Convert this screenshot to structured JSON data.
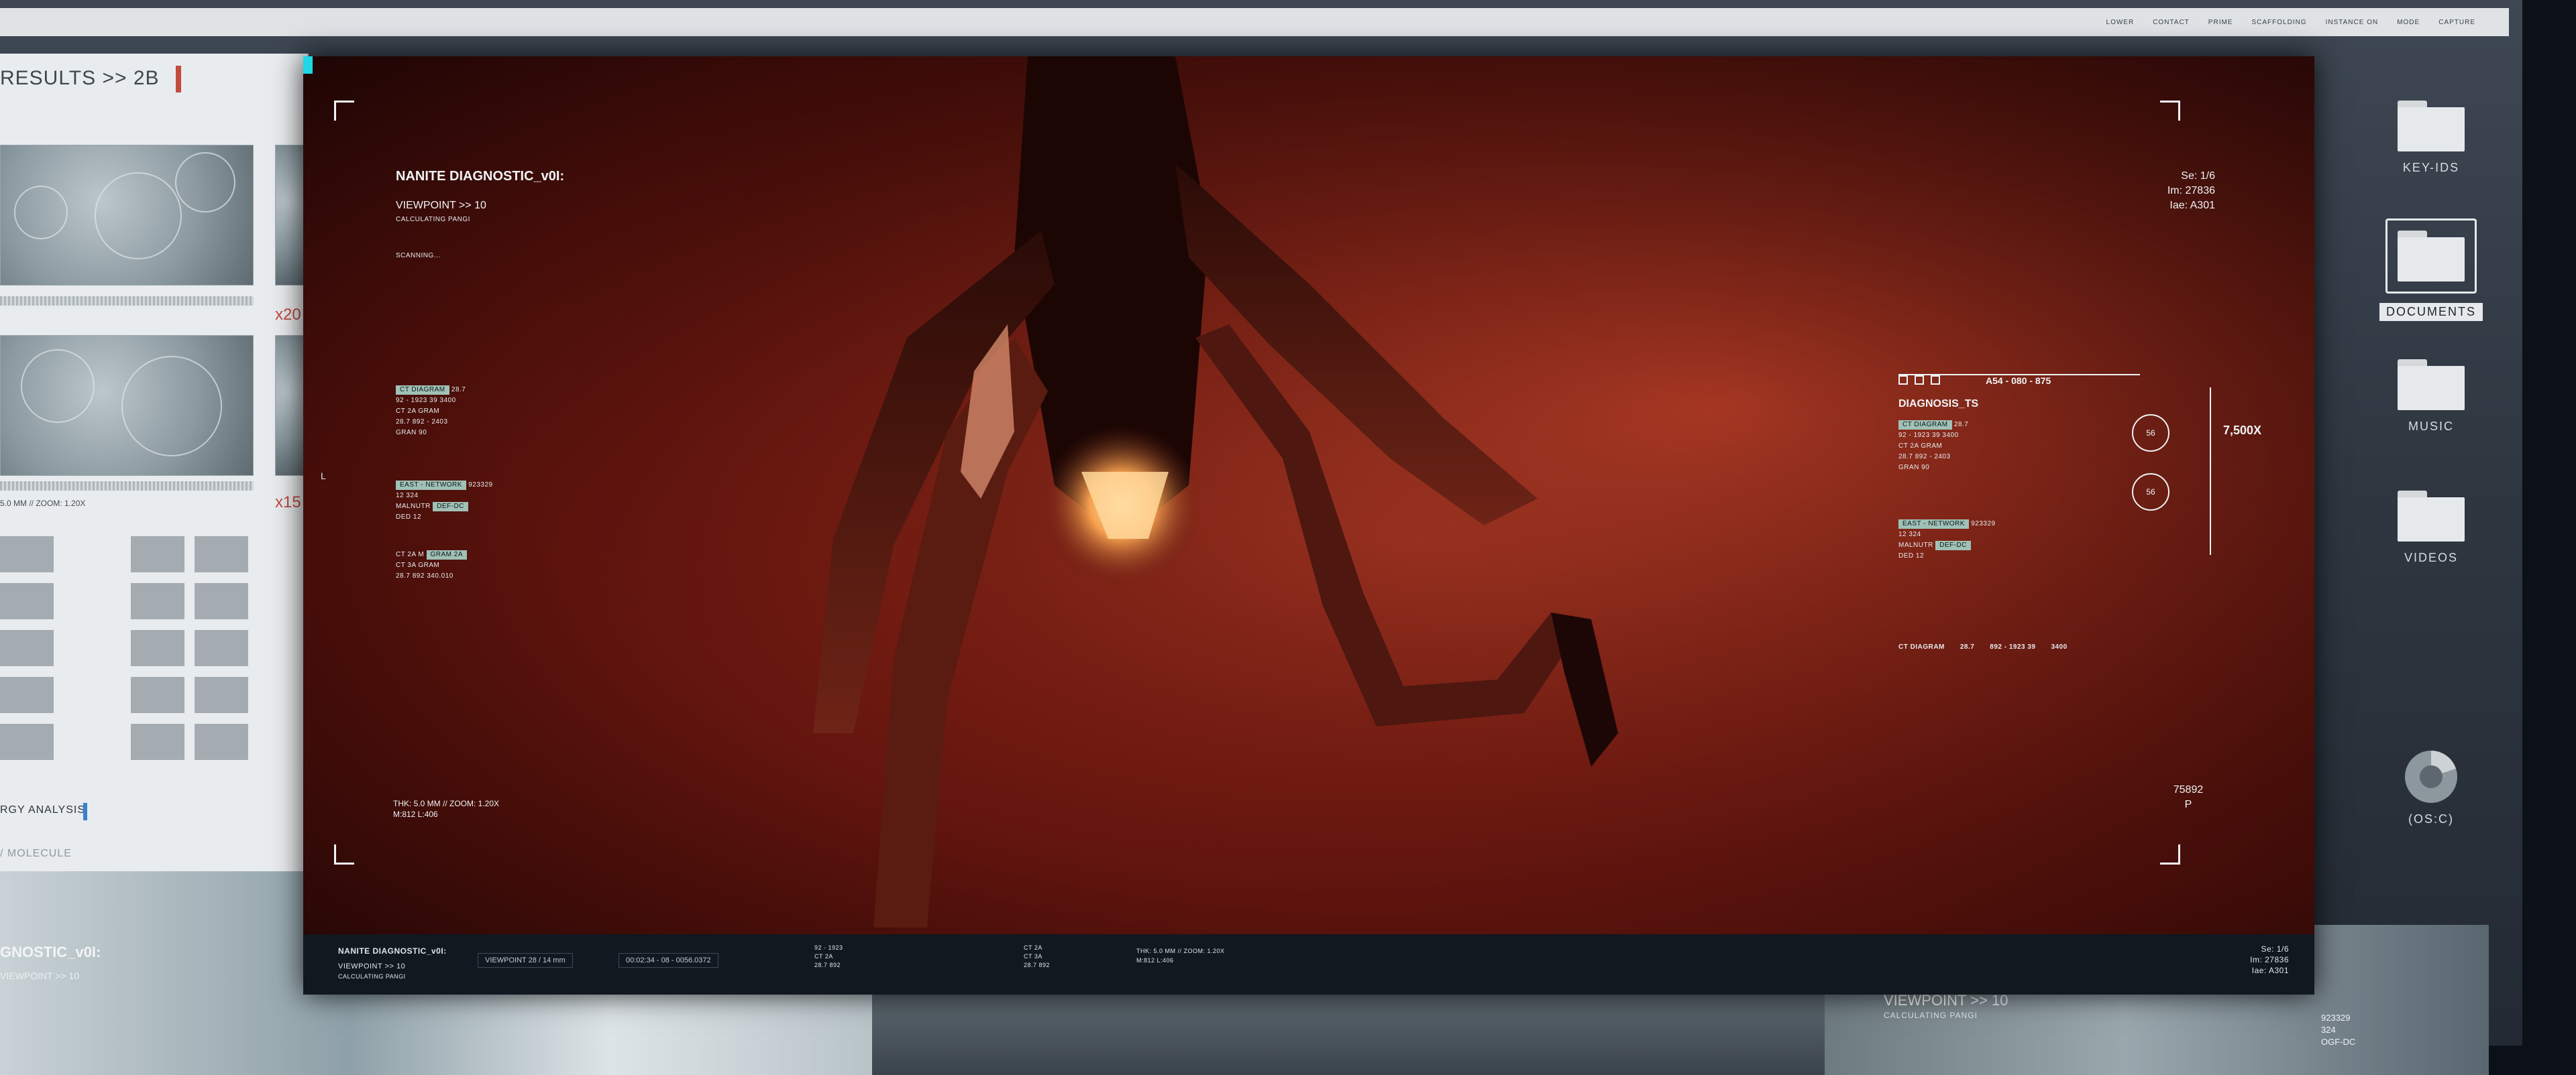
{
  "desktop": {
    "topbar_items": [
      "LOWER",
      "CONTACT",
      "PRIME",
      "SCAFFOLDING",
      "INSTANCE ON",
      "MODE",
      "CAPTURE"
    ],
    "results_title": "RESULTS >> 2B",
    "scale_label_1": "5.0 MM // ZOOM: 1.20X",
    "scale_label_2": "5.0 MM // ZOOM: 1.20X",
    "mag_1": "x20",
    "mag_2": "x15",
    "energy_label": "RGY ANALYSIS",
    "molecule_label": "/ MOLECULE",
    "icons": {
      "key_ids": "KEY-IDS",
      "documents": "DOCUMENTS",
      "music": "MUSIC",
      "videos": "VIDEOS",
      "os": "(OS:C)"
    },
    "bottom_left_title": "GNOSTIC_v0I:",
    "bottom_left_sub": "VIEWPOINT >> 10",
    "bottom_right_viewpoint": "VIEWPOINT >> 10",
    "bottom_right_calc": "CALCULATING PANGI",
    "bottom_right_stats": [
      "923329",
      "324",
      "OGF-DC"
    ]
  },
  "hud": {
    "title": "NANITE DIAGNOSTIC_v0I:",
    "viewpoint": "VIEWPOINT >> 10",
    "calculating": "CALCULATING PANGI",
    "scanning": "SCANNING...",
    "left_block_1": [
      "28.7",
      "92 - 1923   39  3400",
      "CT 2A   GRAM",
      "28.7  892 -   2403",
      "GRAN   90"
    ],
    "left_block_1_tag": "CT DIAGRAM",
    "left_block_2_tag": "EAST - NETWORK",
    "left_block_2": [
      "923329",
      "12   324",
      "MALNUTR",
      "DED  12"
    ],
    "left_block_2_tag_b": "DEF-DC",
    "left_block_3": [
      "CT 2A  M",
      "CT 3A   GRAM",
      "28.7  892   340.010"
    ],
    "left_block_3_tag": "GRAM 2A",
    "scale": "THK: 5.0 MM // ZOOM: 1.20X",
    "mag": "M:812 L:406",
    "top_right": [
      "Se: 1/6",
      "Im: 27836",
      "Iae: A301"
    ],
    "bottom_right": [
      "75892",
      "P"
    ],
    "diag_code": "A54 - 080 - 875",
    "diag_title": "DIAGNOSIS_TS",
    "diag_block_1": [
      "28.7",
      "92 - 1923   39  3400",
      "CT 2A   GRAM",
      "28.7  892 -   2403",
      "GRAN   90"
    ],
    "diag_block_1_tag": "CT DIAGRAM",
    "diag_block_2_tag": "EAST - NETWORK",
    "diag_block_2": [
      "923329",
      "12   324",
      "MALNUTR",
      "DED  12"
    ],
    "diag_block_2_tag_b": "DEF-DC",
    "diag_row": [
      "CT DIAGRAM",
      "28.7",
      "892 - 1923  39",
      "3400"
    ],
    "gauge_1": "56",
    "gauge_2": "56",
    "zoom": "7,500X",
    "left_marker": "L"
  },
  "monitor_bar": {
    "title": "NANITE DIAGNOSTIC_v0I:",
    "viewpoint": "VIEWPOINT >> 10",
    "calc": "CALCULATING PANGI",
    "viewpoint_box": "VIEWPOINT 28 / 14 mm",
    "time_box": "00:02:34 - 08 - 0056.0372",
    "stats_1": [
      "92 - 1923",
      "CT 2A",
      "28.7  892"
    ],
    "stats_2": [
      "CT 2A",
      "CT 3A",
      "28.7  892"
    ],
    "scale": "THK: 5.0 MM // ZOOM: 1.20X",
    "mag": "M:812 L:406",
    "right": [
      "Se: 1/6",
      "Im: 27836",
      "Iae: A301"
    ]
  },
  "colors": {
    "accent_red": "#c24a3f",
    "accent_cyan": "#1fd7e6",
    "tag_green": "#9fc1b6",
    "hud_white": "#f0f3f5"
  }
}
